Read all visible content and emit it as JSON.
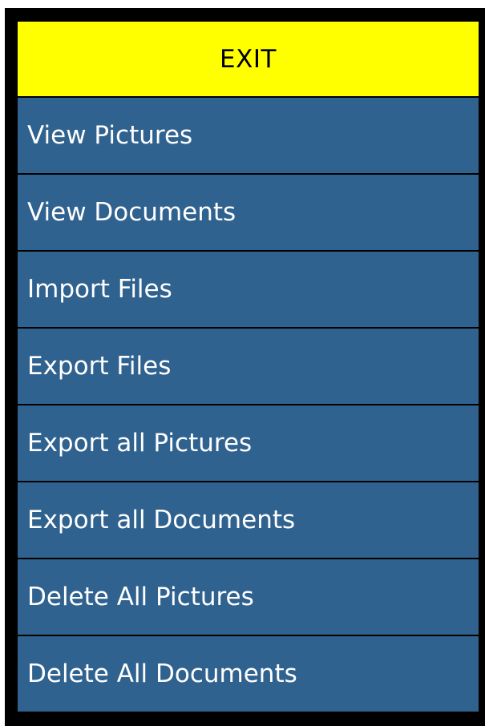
{
  "menu": {
    "exit_label": "EXIT",
    "items": [
      {
        "label": "View Pictures"
      },
      {
        "label": "View Documents"
      },
      {
        "label": "Import Files"
      },
      {
        "label": "Export Files"
      },
      {
        "label": "Export all Pictures"
      },
      {
        "label": "Export all Documents"
      },
      {
        "label": "Delete All Pictures"
      },
      {
        "label": "Delete All Documents"
      }
    ]
  },
  "colors": {
    "background": "#000000",
    "exit_bg": "#ffff00",
    "item_bg": "#30628f",
    "item_text": "#ffffff"
  }
}
